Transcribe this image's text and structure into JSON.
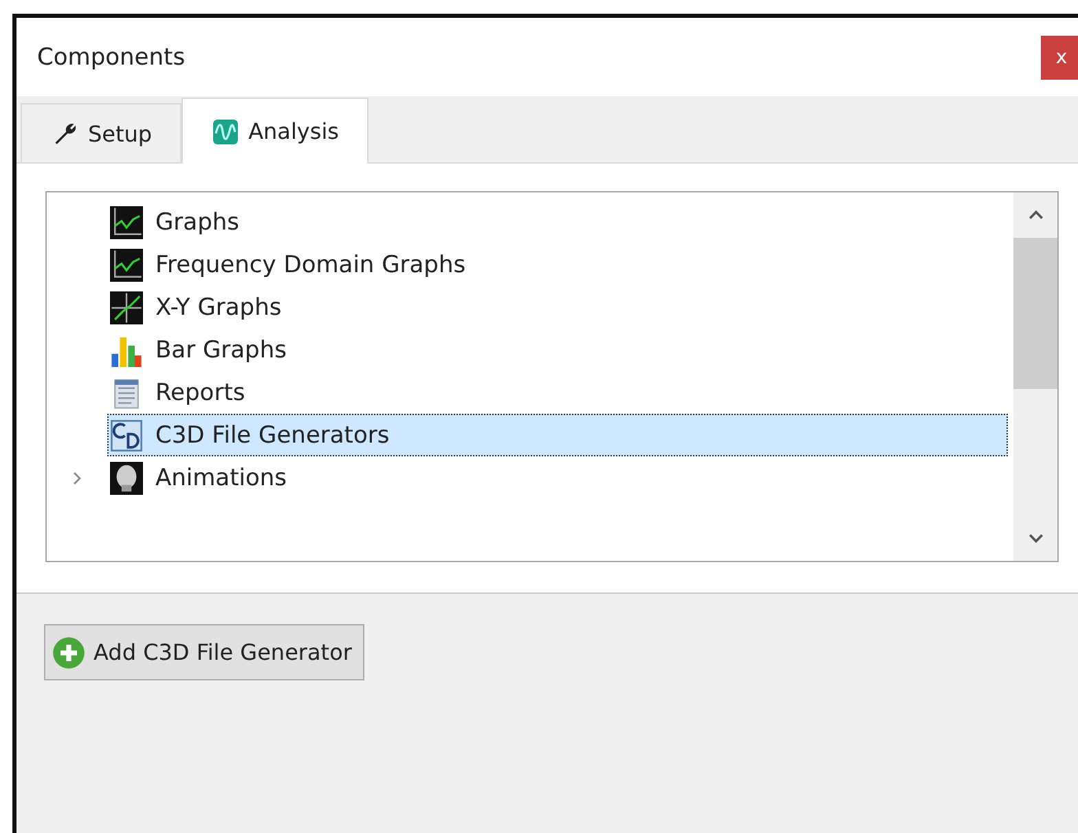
{
  "window": {
    "title": "Components",
    "close": "x"
  },
  "tabs": [
    {
      "label": "Setup",
      "kind": "wrench",
      "selected": false
    },
    {
      "label": "Analysis",
      "kind": "wave",
      "selected": true
    }
  ],
  "items": [
    {
      "label": "Graphs",
      "kind": "graph",
      "expandable": false,
      "selected": false
    },
    {
      "label": "Frequency Domain Graphs",
      "kind": "graph",
      "expandable": false,
      "selected": false
    },
    {
      "label": "X-Y Graphs",
      "kind": "xy",
      "expandable": false,
      "selected": false
    },
    {
      "label": "Bar Graphs",
      "kind": "bar",
      "expandable": false,
      "selected": false
    },
    {
      "label": "Reports",
      "kind": "report",
      "expandable": false,
      "selected": false
    },
    {
      "label": "C3D File Generators",
      "kind": "c3d",
      "expandable": false,
      "selected": true
    },
    {
      "label": "Animations",
      "kind": "animation",
      "expandable": true,
      "selected": false
    }
  ],
  "add_button": "Add C3D File Generator"
}
